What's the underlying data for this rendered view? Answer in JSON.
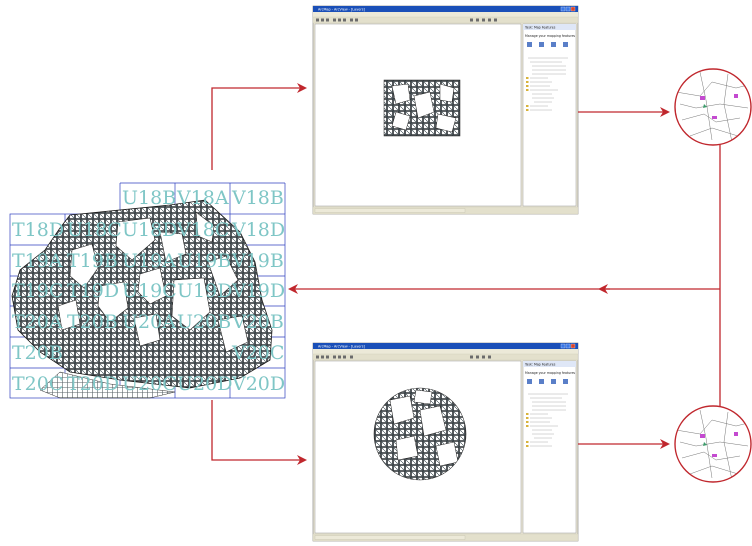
{
  "grid_labels": {
    "row1": [
      "U18B",
      "V18A",
      "V18B"
    ],
    "row2": [
      "T18D",
      "U18C",
      "U18D",
      "V18C",
      "V18D"
    ],
    "row3": [
      "T19A",
      "T19B",
      "U19A",
      "U19B",
      "V19A",
      "V19B"
    ],
    "row4": [
      "T19C",
      "T19D",
      "U19C",
      "U19D",
      "V19C",
      "V19D"
    ],
    "row5": [
      "T20A",
      "T20B",
      "U20A",
      "U20B",
      "V20A",
      "V20B"
    ],
    "row6": [
      "T20C",
      "T20D",
      "U20C",
      "U20D",
      "V20C",
      "V20D"
    ]
  },
  "top_window": {
    "title": "ArcMap - ArcView - [Layers]",
    "panel_title": "Task: Map Features",
    "panel_subtitle": "Manage your mapping features"
  },
  "bottom_window": {
    "title": "ArcMap - ArcView - [Layers]",
    "panel_title": "Task: Map Features",
    "panel_subtitle": "Manage your mapping features"
  },
  "colors": {
    "arrow": "#c0272d",
    "grid_line": "#2f3fbf",
    "grid_text": "#7fc6c6",
    "window_title": "#1a4fb8",
    "window_chrome": "#ece9d8",
    "map_dark": "#2a2f33",
    "map_light": "#ffffff"
  }
}
